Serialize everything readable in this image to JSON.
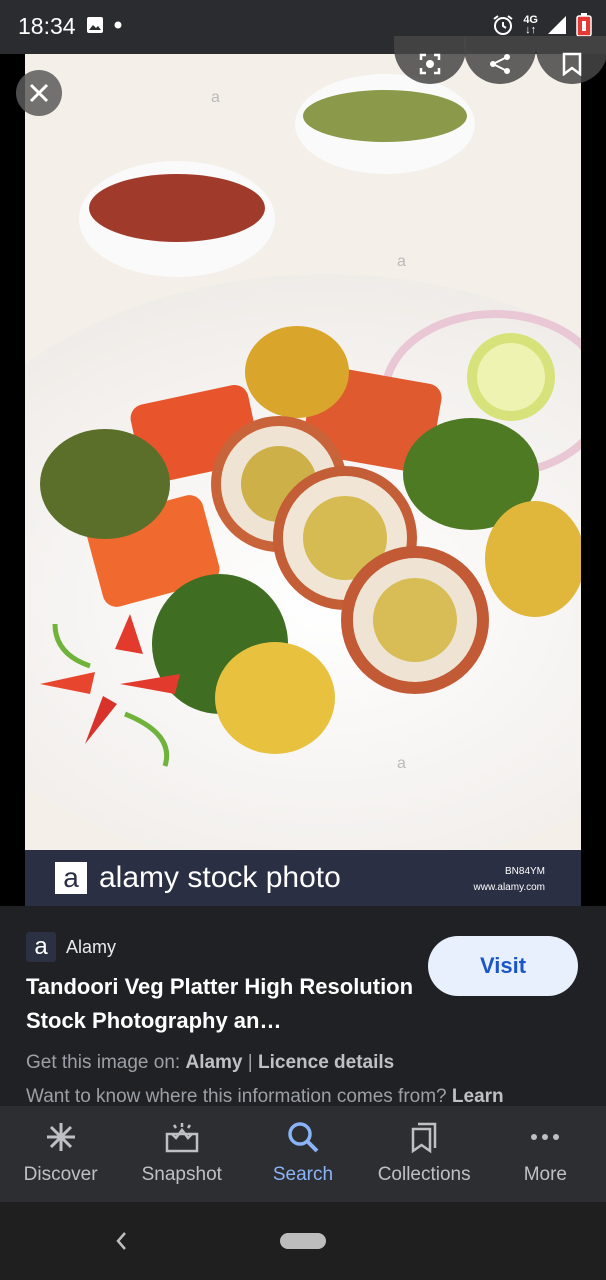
{
  "status_bar": {
    "time": "18:34",
    "network_top": "4G",
    "network_bottom": "↓↑"
  },
  "viewer": {
    "icons": [
      "close-icon",
      "lens-icon",
      "share-icon",
      "bookmark-icon"
    ],
    "banner_logo": "a",
    "banner_text": "alamy stock photo",
    "banner_code": "BN84YM",
    "banner_url": "www.alamy.com",
    "watermark": "alamy"
  },
  "info": {
    "source_logo": "a",
    "source_name": "Alamy",
    "title": "Tandoori Veg Platter High Resolution Stock Photography an…",
    "visit_label": "Visit",
    "get_image_prefix": "Get this image on: ",
    "get_image_source": "Alamy",
    "separator": " | ",
    "licence": "Licence details",
    "want_to_know": "Want to know where this information comes from? ",
    "learn": "Learn"
  },
  "bottom_nav": {
    "items": [
      {
        "label": "Discover",
        "icon": "asterisk-icon"
      },
      {
        "label": "Snapshot",
        "icon": "snapshot-icon"
      },
      {
        "label": "Search",
        "icon": "search-icon"
      },
      {
        "label": "Collections",
        "icon": "collections-icon"
      },
      {
        "label": "More",
        "icon": "more-icon"
      }
    ],
    "active": "Search"
  },
  "colors": {
    "accent": "#8ab4f8",
    "visit_bg": "#e8f0fe",
    "panel_bg": "#202124"
  }
}
